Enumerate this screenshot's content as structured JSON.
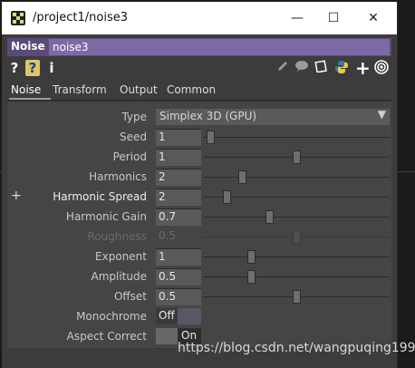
{
  "window": {
    "title": "/project1/noise3",
    "minimize": "—",
    "maximize": "☐",
    "close": "✕"
  },
  "operator": {
    "type_label": "Noise",
    "name": "noise3"
  },
  "toolbar": {
    "help_icon": "?",
    "help_alt_icon": "?",
    "info_icon": "i"
  },
  "tabs": [
    "Noise",
    "Transform",
    "Output",
    "Common"
  ],
  "params": {
    "type": {
      "label": "Type",
      "value": "Simplex 3D (GPU)"
    },
    "seed": {
      "label": "Seed",
      "value": "1",
      "level": 0.02
    },
    "period": {
      "label": "Period",
      "value": "1",
      "level": 0.5
    },
    "harmonics": {
      "label": "Harmonics",
      "value": "2",
      "level": 0.2
    },
    "harmonic_spread": {
      "label": "Harmonic Spread",
      "value": "2",
      "level": 0.11
    },
    "harmonic_gain": {
      "label": "Harmonic Gain",
      "value": "0.7",
      "level": 0.35
    },
    "roughness": {
      "label": "Roughness",
      "value": "0.5",
      "level": 0.5
    },
    "exponent": {
      "label": "Exponent",
      "value": "1",
      "level": 0.25
    },
    "amplitude": {
      "label": "Amplitude",
      "value": "0.5",
      "level": 0.25
    },
    "offset": {
      "label": "Offset",
      "value": "0.5",
      "level": 0.5
    },
    "monochrome": {
      "label": "Monochrome",
      "value": "Off"
    },
    "aspect_correct": {
      "label": "Aspect Correct",
      "value": "On"
    }
  },
  "panel_plus": "+",
  "watermark": "https://blog.csdn.net/wangpuqing1997",
  "colors": {
    "opbar": "#5b4a7a",
    "opname": "#7d6aa5",
    "panel": "#454545"
  }
}
